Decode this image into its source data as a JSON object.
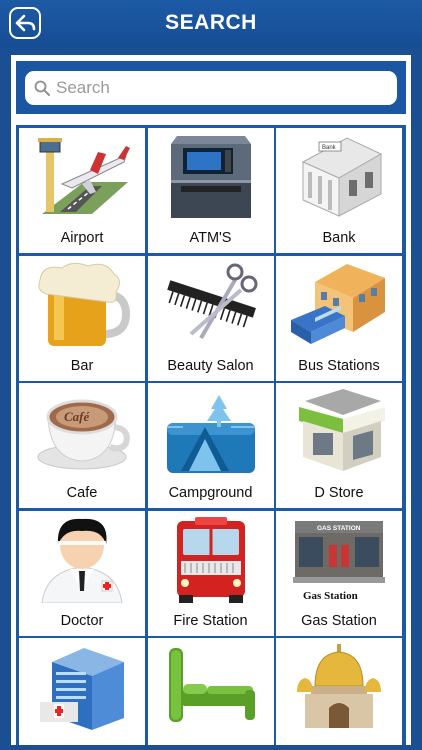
{
  "header": {
    "title": "SEARCH",
    "back_icon": "back-arrow-icon"
  },
  "search": {
    "placeholder": "Search"
  },
  "categories": [
    {
      "label": "Airport",
      "icon": "airport-icon"
    },
    {
      "label": "ATM'S",
      "icon": "atm-icon"
    },
    {
      "label": "Bank",
      "icon": "bank-icon"
    },
    {
      "label": "Bar",
      "icon": "beer-mug-icon"
    },
    {
      "label": "Beauty Salon",
      "icon": "comb-scissors-icon"
    },
    {
      "label": "Bus Stations",
      "icon": "bus-station-icon"
    },
    {
      "label": "Cafe",
      "icon": "coffee-cup-icon"
    },
    {
      "label": "Campground",
      "icon": "campground-icon"
    },
    {
      "label": "D Store",
      "icon": "store-icon"
    },
    {
      "label": "Doctor",
      "icon": "doctor-icon"
    },
    {
      "label": "Fire Station",
      "icon": "fire-truck-icon"
    },
    {
      "label": "Gas Station",
      "icon": "gas-station-icon"
    },
    {
      "label": "",
      "icon": "hospital-icon"
    },
    {
      "label": "",
      "icon": "bed-icon"
    },
    {
      "label": "",
      "icon": "mosque-icon"
    }
  ],
  "icon_text": {
    "bank_sign": "Bank",
    "cafe_art": "Café",
    "gas_sign": "GAS STATION",
    "gas_caption": "Gas Station"
  },
  "colors": {
    "header": "#1a56a1",
    "grid_lines": "#1d5aa6",
    "background": "#1a4f93"
  }
}
